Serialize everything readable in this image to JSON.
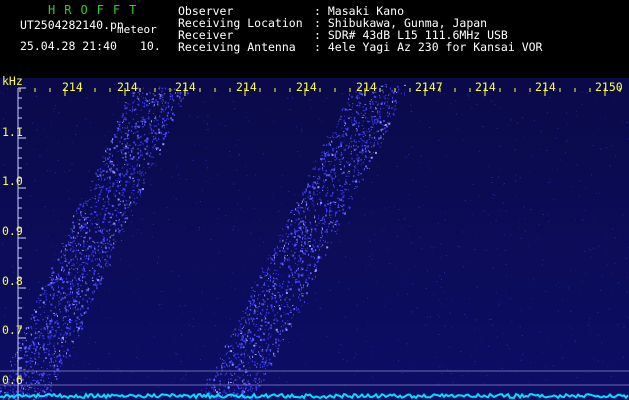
{
  "header": {
    "logo": "HROFFT",
    "filename": "UT2504282140.pn",
    "tag": "meteor",
    "datetime": "25.04.28 21:40",
    "interval": "10.",
    "labels": [
      "Observer",
      "Receiving Location",
      "Receiver",
      "Receiving Antenna"
    ],
    "values": [
      ": Masaki Kano",
      ": Shibukawa, Gunma, Japan",
      ": SDR# 43dB L15 111.6MHz USB",
      ": 4ele Yagi Az 230 for Kansai VOR"
    ]
  },
  "axes": {
    "y_unit": "kHz",
    "x_ticks": [
      "214",
      "214",
      "214",
      "214",
      "214",
      "214",
      "2147",
      "214",
      "214",
      "2150"
    ],
    "y_ticks": [
      "1.1",
      "1.0",
      "0.9",
      "0.8",
      "0.7",
      "0.6"
    ]
  },
  "colors": {
    "background": "#000000",
    "spectrum": "#0a0a5a",
    "trace": "#3a3aff",
    "baseline": "#00e0ff",
    "tick": "#ffff40"
  }
}
